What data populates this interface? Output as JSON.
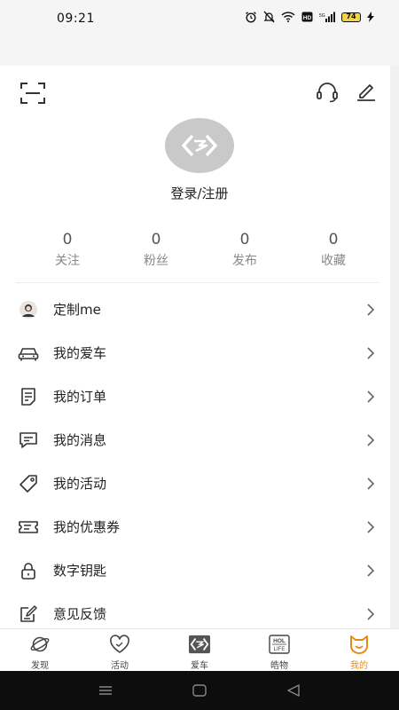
{
  "status_bar": {
    "time": "09:21",
    "battery": "74",
    "icons": [
      "alarm-icon",
      "mute-icon",
      "wifi-icon",
      "hd-icon",
      "signal-icon",
      "battery-icon",
      "charging-icon"
    ]
  },
  "header": {
    "icons": [
      "scan-icon",
      "customer-service-icon",
      "edit-icon"
    ]
  },
  "profile": {
    "login_label": "登录/注册",
    "avatar_color": "#c9c9c9"
  },
  "stats": [
    {
      "count": "0",
      "label": "关注"
    },
    {
      "count": "0",
      "label": "粉丝"
    },
    {
      "count": "0",
      "label": "发布"
    },
    {
      "count": "0",
      "label": "收藏"
    }
  ],
  "menu": [
    {
      "label": "定制me",
      "icon": "user-avatar-icon"
    },
    {
      "label": "我的爱车",
      "icon": "car-icon"
    },
    {
      "label": "我的订单",
      "icon": "order-icon"
    },
    {
      "label": "我的消息",
      "icon": "message-icon"
    },
    {
      "label": "我的活动",
      "icon": "tag-icon"
    },
    {
      "label": "我的优惠券",
      "icon": "coupon-icon"
    },
    {
      "label": "数字钥匙",
      "icon": "lock-icon"
    },
    {
      "label": "意见反馈",
      "icon": "feedback-icon"
    }
  ],
  "tabbar": {
    "accent_color": "#e88a1a",
    "tabs": [
      {
        "label": "发现",
        "icon": "planet-icon",
        "active": false
      },
      {
        "label": "活动",
        "icon": "heart-icon",
        "active": false
      },
      {
        "label": "爱车",
        "icon": "brand-logo-icon",
        "active": false
      },
      {
        "label": "皓物",
        "icon": "hol-life-icon",
        "active": false,
        "logo_text": [
          "HOL",
          "LIFE"
        ]
      },
      {
        "label": "我的",
        "icon": "cat-face-icon",
        "active": true
      }
    ]
  }
}
